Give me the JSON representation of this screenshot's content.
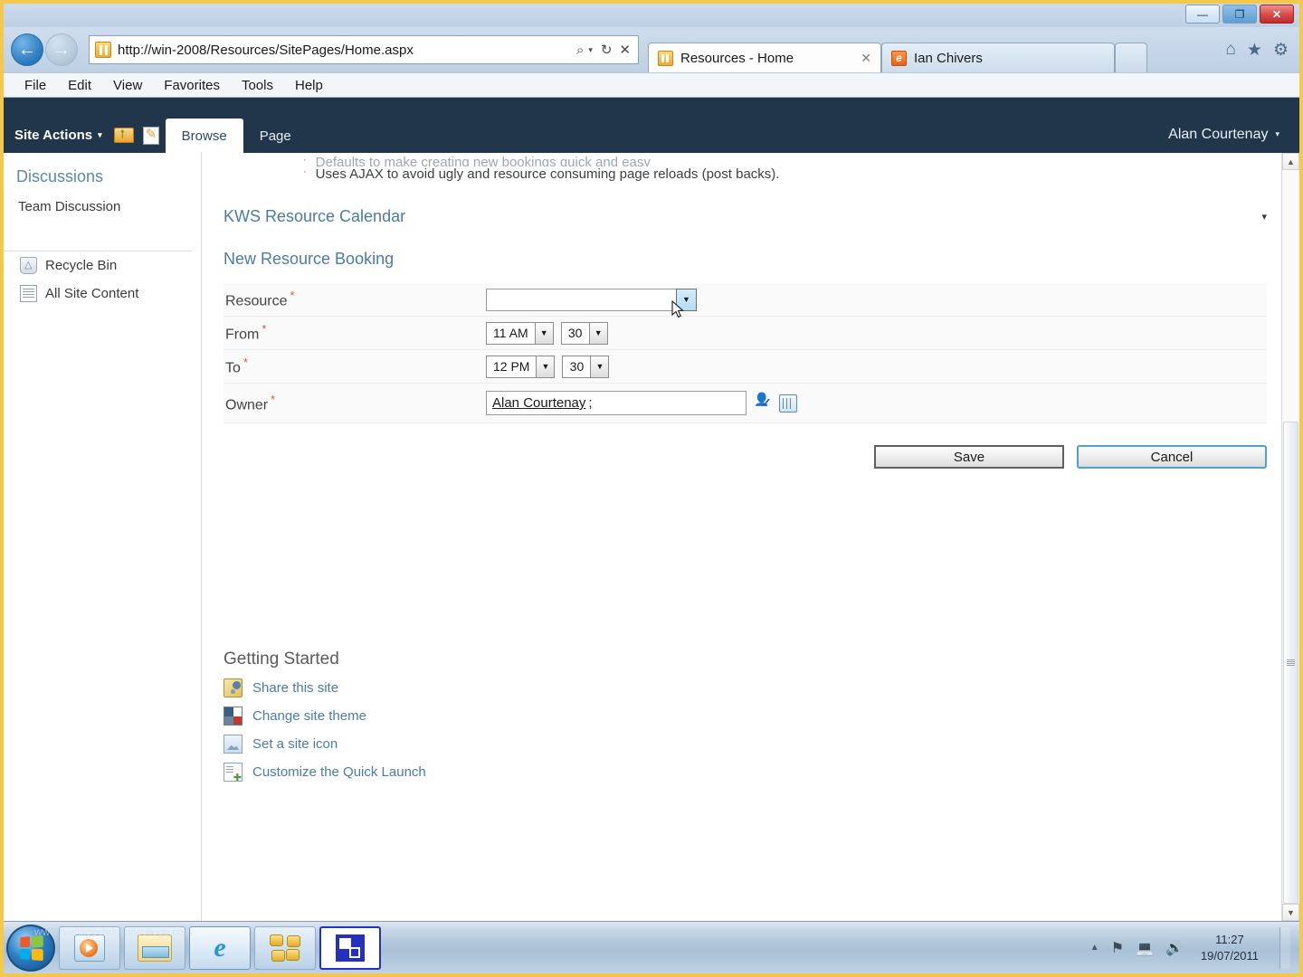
{
  "window": {
    "minimize_label": "—",
    "restore_label": "❐",
    "close_label": "✕"
  },
  "browser": {
    "back_icon": "←",
    "forward_icon": "→",
    "address": "http://win-2008/Resources/SitePages/Home.aspx",
    "search_icon": "⌕",
    "search_caret": "▾",
    "refresh_icon": "↻",
    "stop_icon": "✕",
    "tabs": [
      {
        "label": "Resources - Home",
        "close": "✕",
        "active": true
      },
      {
        "label": "Ian Chivers",
        "favicon_letter": "e",
        "active": false
      }
    ],
    "toolbar_icons": {
      "home": "⌂",
      "favorites": "★",
      "tools": "⚙"
    },
    "menu": [
      "File",
      "Edit",
      "View",
      "Favorites",
      "Tools",
      "Help"
    ]
  },
  "sharepoint": {
    "site_actions_label": "Site Actions",
    "site_actions_caret": "▾",
    "ribbon_tabs": [
      {
        "label": "Browse",
        "active": true
      },
      {
        "label": "Page",
        "active": false
      }
    ],
    "user_menu": {
      "name": "Alan Courtenay",
      "caret": "▾"
    },
    "quick_launch": {
      "heading": "Discussions",
      "team_discussion": "Team Discussion",
      "links": [
        {
          "label": "Recycle Bin"
        },
        {
          "label": "All Site Content"
        }
      ]
    }
  },
  "content": {
    "clipped_bullet": "Defaults to make creating new bookings quick and easy",
    "bullet_dot": "·",
    "visible_bullet": "Uses AJAX to avoid ugly and resource consuming page reloads (post backs).",
    "webpart_title": "KWS Resource Calendar",
    "webpart_menu_caret": "▾",
    "form_heading": "New Resource Booking",
    "form": {
      "required_marker": "*",
      "rows": [
        {
          "label": "Resource",
          "required": true
        },
        {
          "label": "From",
          "required": true
        },
        {
          "label": "To",
          "required": true
        },
        {
          "label": "Owner",
          "required": true
        }
      ],
      "resource_value": "",
      "resource_placeholder": "",
      "dropdown_caret": "▼",
      "from_hour": "11 AM",
      "from_minute": "30",
      "to_hour": "12 PM",
      "to_minute": "30",
      "owner_value": "Alan Courtenay",
      "owner_separator": ";"
    },
    "buttons": {
      "save": "Save",
      "cancel": "Cancel"
    },
    "getting_started": {
      "heading": "Getting Started",
      "links": [
        {
          "label": "Share this site"
        },
        {
          "label": "Change site theme"
        },
        {
          "label": "Set a site icon"
        },
        {
          "label": "Customize the Quick Launch"
        }
      ]
    },
    "scrollbar": {
      "up_arrow": "▲",
      "down_arrow": "▼"
    }
  },
  "taskbar": {
    "watermark": "www.heritagechristiancollege.com",
    "tray": {
      "expand": "▲",
      "flag_icon": "⚑",
      "network_icon": "⌨",
      "volume_icon": "ὐA"
    },
    "clock": {
      "time": "11:27",
      "date": "19/07/2011"
    }
  }
}
